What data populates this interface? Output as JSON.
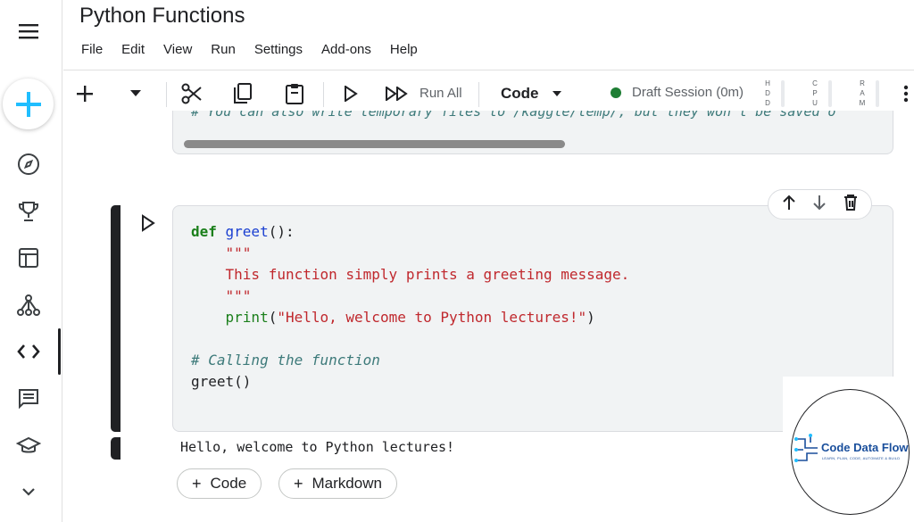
{
  "notebook": {
    "title": "Python Functions"
  },
  "menu": [
    "File",
    "Edit",
    "View",
    "Run",
    "Settings",
    "Add-ons",
    "Help"
  ],
  "toolbar": {
    "run_all_label": "Run All",
    "cell_type": "Code",
    "session_status": "Draft Session (0m)",
    "meters": [
      {
        "name": "HDD",
        "letters": [
          "H",
          "D",
          "D"
        ]
      },
      {
        "name": "CPU",
        "letters": [
          "C",
          "P",
          "U"
        ]
      },
      {
        "name": "RAM",
        "letters": [
          "R",
          "A",
          "M"
        ]
      }
    ]
  },
  "previous_cell": {
    "visible_code": "# You can also write temporary files to /kaggle/temp/, but they won't be saved o"
  },
  "active_cell": {
    "code_lines": [
      "def greet():",
      "    \"\"\"",
      "    This function simply prints a greeting message.",
      "    \"\"\"",
      "    print(\"Hello, welcome to Python lectures!\")",
      "",
      "# Calling the function",
      "greet()"
    ],
    "output": "Hello, welcome to Python lectures!"
  },
  "add_cell": {
    "code_label": "Code",
    "markdown_label": "Markdown"
  },
  "watermark": {
    "name": "Code Data Flow",
    "tagline": "LEARN, PLAN, CODE, AUTOMATE & BUILD"
  },
  "colors": {
    "accent": "#1a73e8",
    "session_green": "#1e7e34",
    "keyword": "#1b7f1b",
    "string": "#c0282d",
    "comment": "#3d7a7a",
    "function": "#1a3fd1"
  },
  "icons": [
    "menu-icon",
    "create-icon",
    "compass-icon",
    "trophy-icon",
    "table-icon",
    "models-icon",
    "code-icon",
    "discussion-icon",
    "learn-icon",
    "chevron-down-icon"
  ]
}
